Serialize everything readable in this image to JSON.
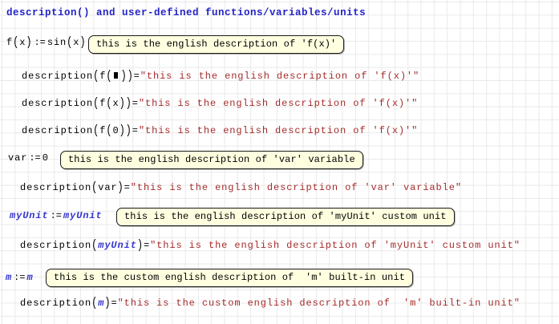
{
  "title": "description() and user-defined functions/variables/units",
  "colors": {
    "title_blue": "#2323c8",
    "unit_blue": "#3535cf",
    "string_red": "#a52c2c",
    "note_background": "#ffffe0",
    "note_border": "#1a1a1a",
    "grid_line": "#e9e9e9",
    "canvas_background": "#ffffff"
  },
  "rows": [
    {
      "expr": [
        {
          "t": "f",
          "c": "k"
        },
        {
          "t": "(",
          "c": "p"
        },
        {
          "t": "x",
          "c": "k"
        },
        {
          "t": ")",
          "c": "p"
        },
        {
          "t": ":=",
          "c": "op"
        },
        {
          "t": "sin",
          "c": "k"
        },
        {
          "t": "(",
          "c": "p"
        },
        {
          "t": "x",
          "c": "k"
        },
        {
          "t": ")",
          "c": "p"
        }
      ],
      "note": "this is the english description of 'f(x)'"
    },
    {
      "expr": [
        {
          "t": "description",
          "c": "k"
        },
        {
          "t": "(",
          "c": "p"
        },
        {
          "t": "f",
          "c": "k"
        },
        {
          "t": "(",
          "c": "p"
        },
        {
          "t": "▪",
          "c": "ph"
        },
        {
          "t": ")",
          "c": "p"
        },
        {
          "t": ")",
          "c": "p"
        },
        {
          "t": "=",
          "c": "k"
        },
        {
          "t": "\"this is the english description of 'f(x)'\"",
          "c": "s"
        }
      ]
    },
    {
      "expr": [
        {
          "t": "description",
          "c": "k"
        },
        {
          "t": "(",
          "c": "p"
        },
        {
          "t": "f",
          "c": "k"
        },
        {
          "t": "(",
          "c": "p"
        },
        {
          "t": "x",
          "c": "k"
        },
        {
          "t": ")",
          "c": "p"
        },
        {
          "t": ")",
          "c": "p"
        },
        {
          "t": "=",
          "c": "k"
        },
        {
          "t": "\"this is the english description of 'f(x)'\"",
          "c": "s"
        }
      ]
    },
    {
      "expr": [
        {
          "t": "description",
          "c": "k"
        },
        {
          "t": "(",
          "c": "p"
        },
        {
          "t": "f",
          "c": "k"
        },
        {
          "t": "(",
          "c": "p"
        },
        {
          "t": "0",
          "c": "k"
        },
        {
          "t": ")",
          "c": "p"
        },
        {
          "t": ")",
          "c": "p"
        },
        {
          "t": "=",
          "c": "k"
        },
        {
          "t": "\"this is the english description of 'f(x)'\"",
          "c": "s"
        }
      ]
    },
    {
      "expr": [
        {
          "t": "var",
          "c": "k"
        },
        {
          "t": ":=",
          "c": "op"
        },
        {
          "t": "0",
          "c": "k"
        }
      ],
      "note": "this is the english description of 'var' variable"
    },
    {
      "expr": [
        {
          "t": "description",
          "c": "k"
        },
        {
          "t": "(",
          "c": "p"
        },
        {
          "t": "var",
          "c": "k"
        },
        {
          "t": ")",
          "c": "p"
        },
        {
          "t": "=",
          "c": "k"
        },
        {
          "t": "\"this is the english description of 'var' variable\"",
          "c": "s"
        }
      ]
    },
    {
      "expr": [
        {
          "t": "myUnit",
          "c": "u"
        },
        {
          "t": ":=",
          "c": "op"
        },
        {
          "t": "myUnit",
          "c": "u"
        }
      ],
      "note": "this is the english description of 'myUnit' custom unit"
    },
    {
      "expr": [
        {
          "t": "description",
          "c": "k"
        },
        {
          "t": "(",
          "c": "p"
        },
        {
          "t": "myUnit",
          "c": "u"
        },
        {
          "t": ")",
          "c": "p"
        },
        {
          "t": "=",
          "c": "k"
        },
        {
          "t": "\"this is the english description of 'myUnit' custom unit\"",
          "c": "s"
        }
      ]
    },
    {
      "expr": [
        {
          "t": "m",
          "c": "u"
        },
        {
          "t": ":=",
          "c": "op"
        },
        {
          "t": "m",
          "c": "u"
        }
      ],
      "note": "this is the custom english description of  'm' built-in unit"
    },
    {
      "expr": [
        {
          "t": "description",
          "c": "k"
        },
        {
          "t": "(",
          "c": "p"
        },
        {
          "t": "m",
          "c": "u"
        },
        {
          "t": ")",
          "c": "p"
        },
        {
          "t": "=",
          "c": "k"
        },
        {
          "t": "\"this is the custom english description of  'm' built-in unit\"",
          "c": "s"
        }
      ]
    }
  ]
}
